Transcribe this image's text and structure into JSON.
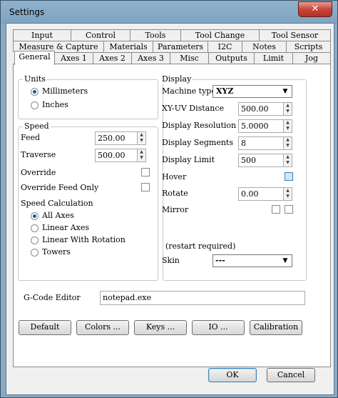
{
  "window": {
    "title": "Settings",
    "close_glyph": "✕"
  },
  "tabs_row1": [
    "Input",
    "Control",
    "Tools",
    "Tool Change",
    "Tool Sensor"
  ],
  "tabs_row2": [
    "Measure & Capture",
    "Materials",
    "Parameters",
    "I2C",
    "Notes",
    "Scripts"
  ],
  "tabs_row3": [
    "General",
    "Axes 1",
    "Axes 2",
    "Axes 3",
    "Misc",
    "Outputs",
    "Limit",
    "Jog"
  ],
  "active_tab": "General",
  "units": {
    "title": "Units",
    "options": [
      "Millimeters",
      "Inches"
    ],
    "selected": "Millimeters"
  },
  "speed": {
    "title": "Speed",
    "feed_label": "Feed",
    "feed_value": "250.00",
    "traverse_label": "Traverse",
    "traverse_value": "500.00",
    "override_label": "Override",
    "override_feed_only_label": "Override Feed Only",
    "calc_title": "Speed Calculation",
    "calc_options": [
      "All Axes",
      "Linear Axes",
      "Linear With Rotation",
      "Towers"
    ],
    "calc_selected": "All Axes"
  },
  "display": {
    "title": "Display",
    "machine_type_label": "Machine type",
    "machine_type_value": "XYZ",
    "xy_uv_label": "XY-UV Distance",
    "xy_uv_value": "500.00",
    "resolution_label": "Display Resolution",
    "resolution_value": "5.0000",
    "segments_label": "Display Segments",
    "segments_value": "8",
    "limit_label": "Display Limit",
    "limit_value": "500",
    "hover_label": "Hover",
    "rotate_label": "Rotate",
    "rotate_value": "0.00",
    "mirror_label": "Mirror",
    "restart_note": "(restart required)",
    "skin_label": "Skin",
    "skin_value": "---"
  },
  "gcode": {
    "label": "G-Code Editor",
    "value": "notepad.exe"
  },
  "buttons": [
    "Default",
    "Colors ...",
    "Keys ...",
    "IO ...",
    "Calibration"
  ],
  "ok_label": "OK",
  "cancel_label": "Cancel",
  "icons": {
    "dropdown": "chevron-down-icon",
    "spin_up": "▲",
    "spin_down": "▼",
    "arrow": "▼"
  }
}
